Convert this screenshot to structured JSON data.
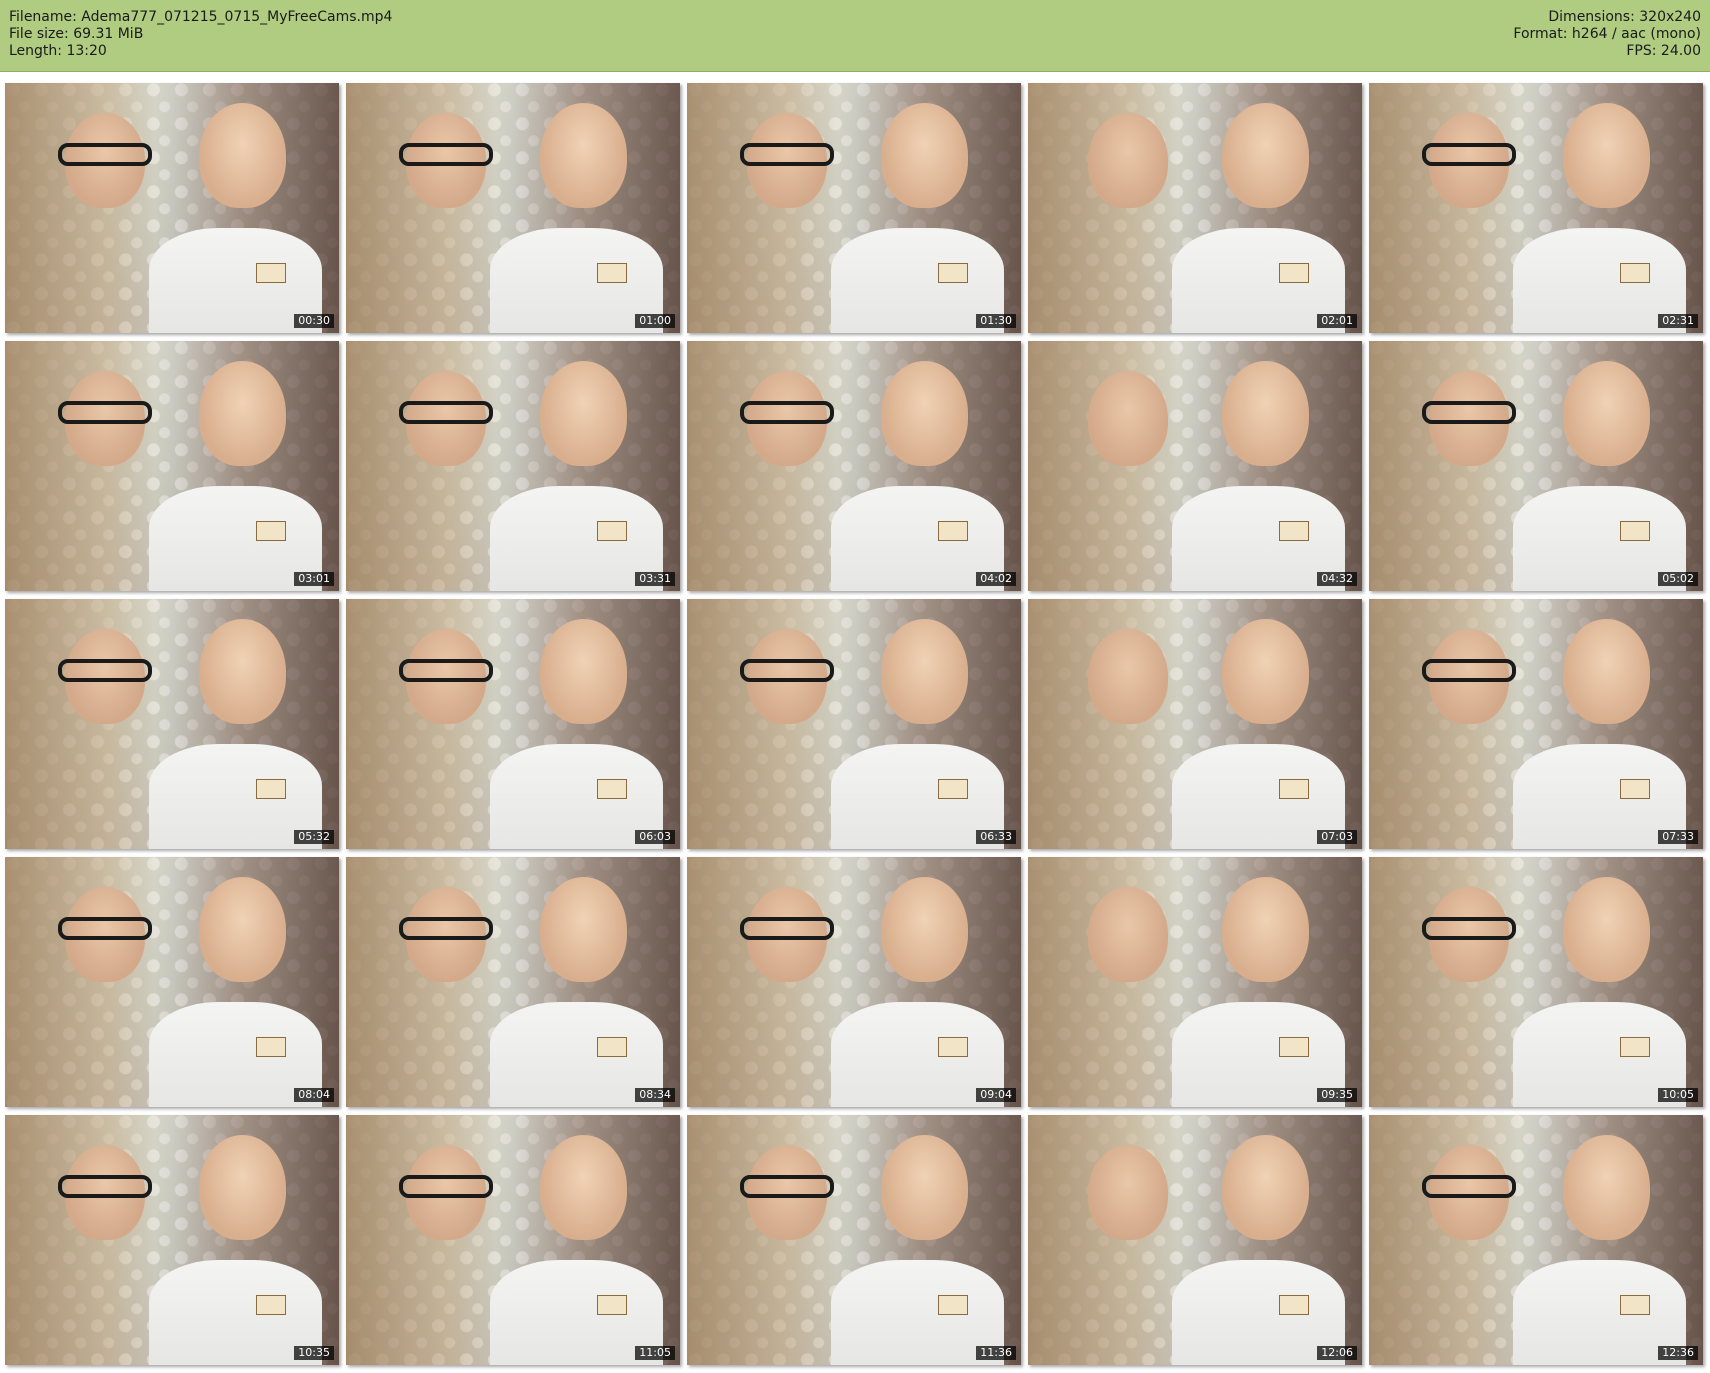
{
  "header": {
    "filename": "Filename: Adema777_071215_0715_MyFreeCams.mp4",
    "filesize": "File size: 69.31 MiB",
    "length": "Length: 13:20",
    "dimensions": "Dimensions: 320x240",
    "format": "Format: h264 / aac (mono)",
    "fps": "FPS: 24.00",
    "background_color": "#b0cc80"
  },
  "thumbnails": [
    {
      "time": "00:30"
    },
    {
      "time": "01:00"
    },
    {
      "time": "01:30"
    },
    {
      "time": "02:01"
    },
    {
      "time": "02:31"
    },
    {
      "time": "03:01"
    },
    {
      "time": "03:31"
    },
    {
      "time": "04:02"
    },
    {
      "time": "04:32"
    },
    {
      "time": "05:02"
    },
    {
      "time": "05:32"
    },
    {
      "time": "06:03"
    },
    {
      "time": "06:33"
    },
    {
      "time": "07:03"
    },
    {
      "time": "07:33"
    },
    {
      "time": "08:04"
    },
    {
      "time": "08:34"
    },
    {
      "time": "09:04"
    },
    {
      "time": "09:35"
    },
    {
      "time": "10:05"
    },
    {
      "time": "10:35"
    },
    {
      "time": "11:05"
    },
    {
      "time": "11:36"
    },
    {
      "time": "12:06"
    },
    {
      "time": "12:36"
    }
  ]
}
